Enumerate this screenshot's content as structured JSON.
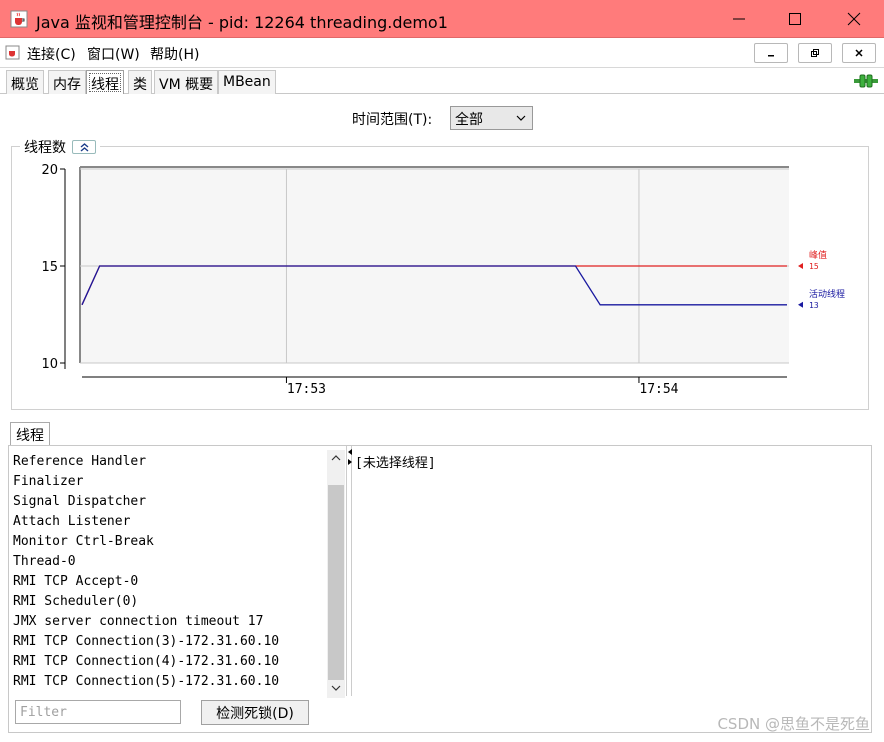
{
  "window": {
    "title": "Java 监视和管理控制台 - pid: 12264 threading.demo1",
    "titlebar_color": "#ff7b7b"
  },
  "menu": {
    "items": [
      "连接(C)",
      "窗口(W)",
      "帮助(H)"
    ]
  },
  "tabs": [
    {
      "label": "概览",
      "active": false
    },
    {
      "label": "内存",
      "active": false
    },
    {
      "label": "线程",
      "active": true
    },
    {
      "label": "类",
      "active": false
    },
    {
      "label": "VM 概要",
      "active": false
    },
    {
      "label": "MBean",
      "active": false
    }
  ],
  "time_range": {
    "label": "时间范围(T):",
    "selected": "全部"
  },
  "thread_count_panel": {
    "title": "线程数"
  },
  "chart_data": {
    "type": "line",
    "xlabel": "",
    "ylabel": "",
    "x_ticks": [
      "17:53",
      "17:54"
    ],
    "y_ticks": [
      10,
      15,
      20
    ],
    "ylim": [
      10,
      20
    ],
    "grid": true,
    "series": [
      {
        "name": "峰值",
        "color": "#e02020",
        "current": 15,
        "points": [
          [
            0,
            13
          ],
          [
            0.025,
            15
          ],
          [
            0.46,
            15
          ],
          [
            0.7,
            15
          ],
          [
            1.0,
            15
          ]
        ]
      },
      {
        "name": "活动线程",
        "color": "#1a1aa0",
        "current": 13,
        "points": [
          [
            0,
            13
          ],
          [
            0.025,
            15
          ],
          [
            0.7,
            15
          ],
          [
            0.735,
            13
          ],
          [
            1.0,
            13
          ]
        ]
      }
    ],
    "legend_placement": "right"
  },
  "threads": {
    "tab_label": "线程",
    "list": [
      "Reference Handler",
      "Finalizer",
      "Signal Dispatcher",
      "Attach Listener",
      "Monitor Ctrl-Break",
      "Thread-0",
      "RMI TCP Accept-0",
      "RMI Scheduler(0)",
      "JMX server connection timeout 17",
      "RMI TCP Connection(3)-172.31.60.10",
      "RMI TCP Connection(4)-172.31.60.10",
      "RMI TCP Connection(5)-172.31.60.10"
    ],
    "detail": "[未选择线程]",
    "filter_placeholder": "Filter",
    "deadlock_button": "检测死锁(D)"
  },
  "watermark": "CSDN @思鱼不是死鱼"
}
